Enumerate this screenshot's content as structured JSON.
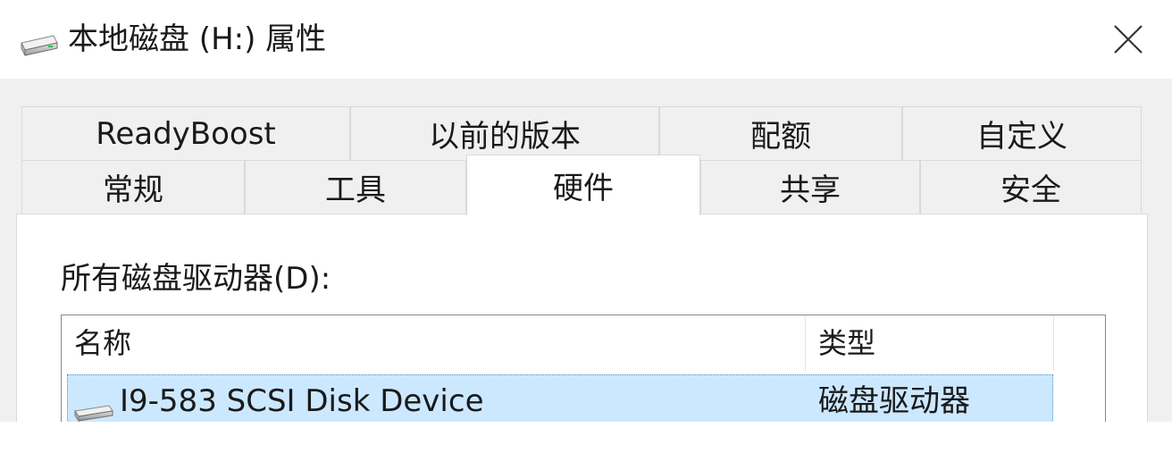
{
  "window": {
    "title": "本地磁盘 (H:) 属性",
    "title_icon": "drive-icon",
    "close_icon": "close-icon"
  },
  "tabs": {
    "row1": [
      "ReadyBoost",
      "以前的版本",
      "配额",
      "自定义"
    ],
    "row2": [
      "常规",
      "工具",
      "硬件",
      "共享",
      "安全"
    ],
    "active": "硬件"
  },
  "hardware": {
    "label": "所有磁盘驱动器(D):",
    "columns": {
      "name": "名称",
      "type": "类型"
    },
    "rows": [
      {
        "name": "I9-583  SCSI Disk Device",
        "type": "磁盘驱动器",
        "icon": "disk-drive-icon",
        "selected": true
      }
    ]
  },
  "colors": {
    "dialog_bg": "#f0f0f0",
    "selection_bg": "#cce8ff",
    "selection_border": "#5a8fc7"
  }
}
